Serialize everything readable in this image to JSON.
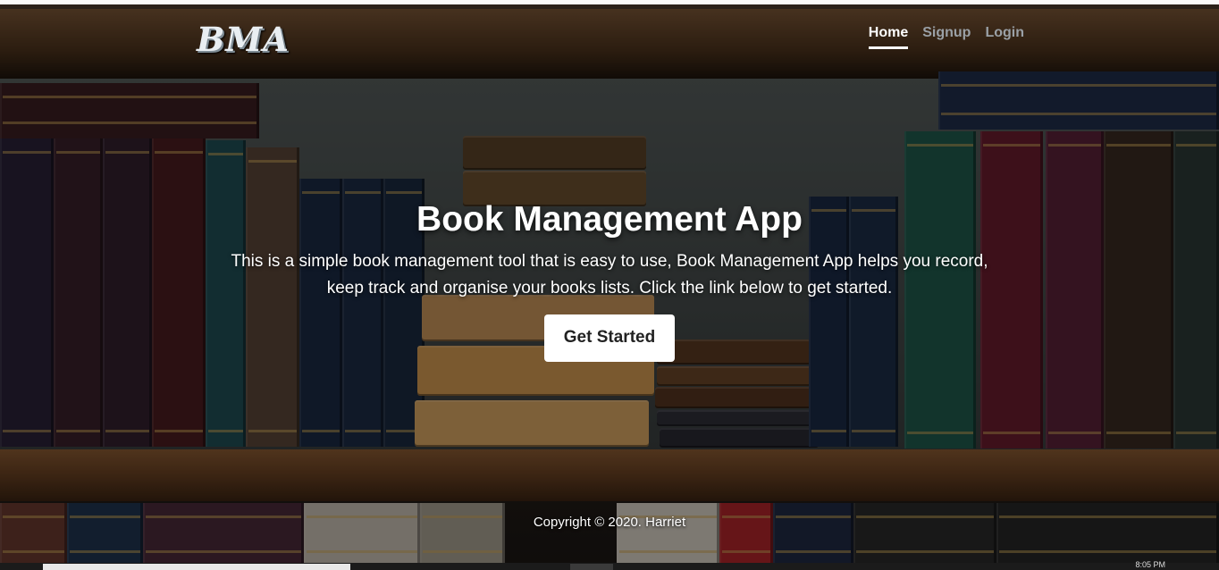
{
  "nav": {
    "brand": "BMA",
    "links": [
      {
        "label": "Home",
        "active": true
      },
      {
        "label": "Signup",
        "active": false
      },
      {
        "label": "Login",
        "active": false
      }
    ]
  },
  "hero": {
    "title": "Book Management App",
    "description": "This is a simple book management tool that is easy to use, Book Management App helps you record, keep track and organise your books lists. Click the link below to get started.",
    "cta_label": "Get Started"
  },
  "footer": {
    "copyright": "Copyright © 2020. Harriet"
  },
  "taskbar": {
    "clock": "8:05 PM"
  },
  "colors": {
    "nav_active": "#ffffff",
    "nav_inactive": "#9aa0a6",
    "cta_bg": "#ffffff",
    "cta_text": "#222222"
  }
}
